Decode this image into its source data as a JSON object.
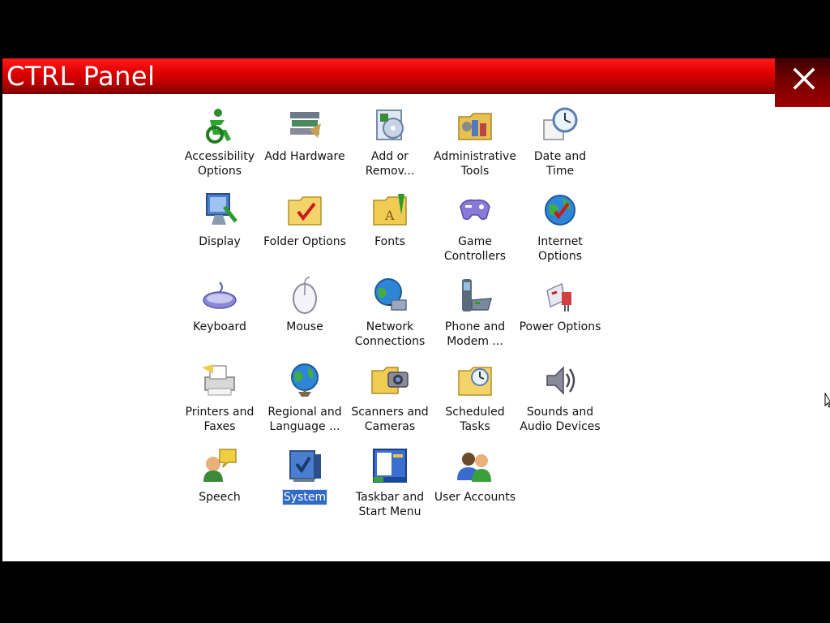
{
  "window": {
    "title": "CTRL Panel",
    "close_label": "close"
  },
  "items": [
    {
      "label": "Accessibility Options",
      "icon": "accessibility-icon",
      "selected": false
    },
    {
      "label": "Add Hardware",
      "icon": "add-hardware-icon",
      "selected": false
    },
    {
      "label": "Add or Remov...",
      "icon": "add-remove-programs-icon",
      "selected": false
    },
    {
      "label": "Administrative Tools",
      "icon": "administrative-tools-icon",
      "selected": false
    },
    {
      "label": "Date and Time",
      "icon": "date-time-icon",
      "selected": false
    },
    {
      "label": "Display",
      "icon": "display-icon",
      "selected": false
    },
    {
      "label": "Folder Options",
      "icon": "folder-options-icon",
      "selected": false
    },
    {
      "label": "Fonts",
      "icon": "fonts-icon",
      "selected": false
    },
    {
      "label": "Game Controllers",
      "icon": "game-controllers-icon",
      "selected": false
    },
    {
      "label": "Internet Options",
      "icon": "internet-options-icon",
      "selected": false
    },
    {
      "label": "Keyboard",
      "icon": "keyboard-icon",
      "selected": false
    },
    {
      "label": "Mouse",
      "icon": "mouse-icon",
      "selected": false
    },
    {
      "label": "Network Connections",
      "icon": "network-connections-icon",
      "selected": false
    },
    {
      "label": "Phone and Modem ...",
      "icon": "phone-modem-icon",
      "selected": false
    },
    {
      "label": "Power Options",
      "icon": "power-options-icon",
      "selected": false
    },
    {
      "label": "Printers and Faxes",
      "icon": "printers-faxes-icon",
      "selected": false
    },
    {
      "label": "Regional and Language ...",
      "icon": "regional-language-icon",
      "selected": false
    },
    {
      "label": "Scanners and Cameras",
      "icon": "scanners-cameras-icon",
      "selected": false
    },
    {
      "label": "Scheduled Tasks",
      "icon": "scheduled-tasks-icon",
      "selected": false
    },
    {
      "label": "Sounds and Audio Devices",
      "icon": "sounds-audio-icon",
      "selected": false
    },
    {
      "label": "Speech",
      "icon": "speech-icon",
      "selected": false
    },
    {
      "label": "System",
      "icon": "system-icon",
      "selected": true
    },
    {
      "label": "Taskbar and Start Menu",
      "icon": "taskbar-start-menu-icon",
      "selected": false
    },
    {
      "label": "User Accounts",
      "icon": "user-accounts-icon",
      "selected": false
    }
  ],
  "colors": {
    "title_bar": "#e00000",
    "selection": "#316ac5"
  }
}
